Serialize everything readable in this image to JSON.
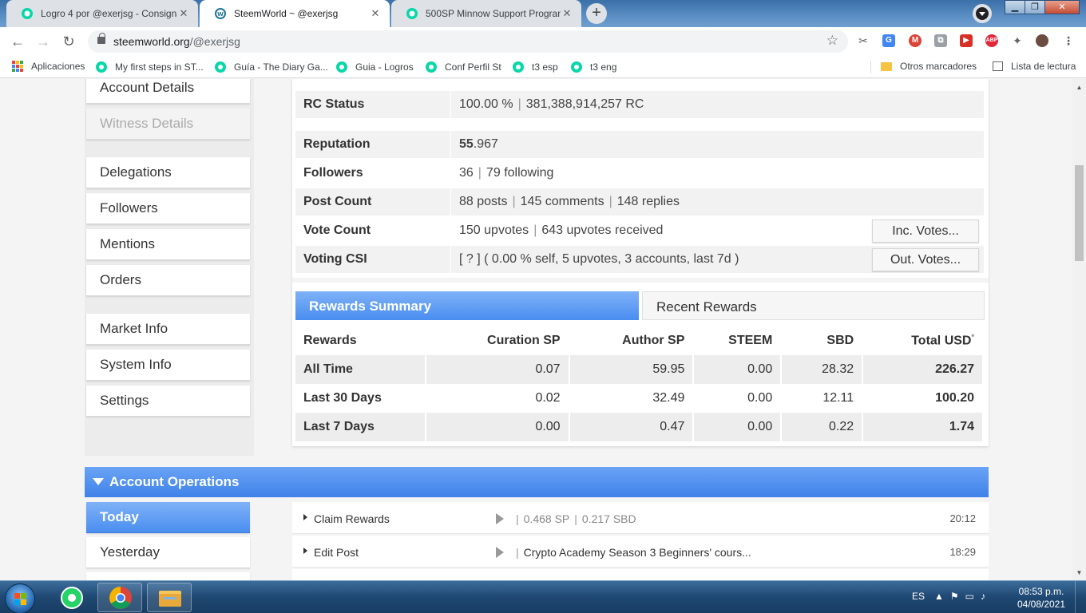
{
  "browser": {
    "tabs": [
      {
        "title": "Logro 4 por @exerjsg - Consigna",
        "active": false
      },
      {
        "title": "SteemWorld ~ @exerjsg",
        "active": true
      },
      {
        "title": "500SP Minnow Support Program",
        "active": false
      }
    ],
    "close_glyph": "✕",
    "new_tab_glyph": "+",
    "address": {
      "host": "steemworld.org",
      "path": "/@exerjsg"
    },
    "bookmarks": [
      {
        "label": "Aplicaciones"
      },
      {
        "label": "My first steps in ST..."
      },
      {
        "label": "Guía - The Diary Ga..."
      },
      {
        "label": "Guia - Logros"
      },
      {
        "label": "Conf Perfil St"
      },
      {
        "label": "t3 esp"
      },
      {
        "label": "t3 eng"
      }
    ],
    "other_bookmarks": "Otros marcadores",
    "reading_list": "Lista de lectura",
    "extensions": [
      {
        "label": "ABP",
        "color": "#e0283a"
      }
    ]
  },
  "sidebar": {
    "items": [
      {
        "label": "Account Details"
      },
      {
        "label": "Witness Details"
      },
      {
        "label": "Delegations"
      },
      {
        "label": "Followers"
      },
      {
        "label": "Mentions"
      },
      {
        "label": "Orders"
      },
      {
        "label": "Market Info"
      },
      {
        "label": "System Info"
      },
      {
        "label": "Settings"
      }
    ]
  },
  "account": {
    "rows": [
      {
        "key": "RC Status",
        "value": "100.00 %",
        "value2": "381,388,914,257 RC"
      },
      {
        "key": "Reputation",
        "value_bold": "55",
        "value_rest": ".967"
      },
      {
        "key": "Followers",
        "value": "36",
        "value2": "79 following"
      },
      {
        "key": "Post Count",
        "value": "88 posts",
        "value2": "145 comments",
        "value3": "148 replies"
      },
      {
        "key": "Vote Count",
        "value": "150 upvotes",
        "value2": "643 upvotes received",
        "button": "Inc. Votes..."
      },
      {
        "key": "Voting CSI",
        "value": "[ ? ] ( 0.00 % self, 5 upvotes, 3 accounts, last 7d )",
        "button": "Out. Votes..."
      }
    ],
    "separator": "|"
  },
  "rewards": {
    "tabs": {
      "summary": "Rewards Summary",
      "recent": "Recent Rewards"
    },
    "columns": [
      "Rewards",
      "Curation SP",
      "Author SP",
      "STEEM",
      "SBD",
      "Total USD"
    ],
    "total_marker": "*",
    "rows": [
      {
        "label": "All Time",
        "curation": "0.07",
        "author": "59.95",
        "steem": "0.00",
        "sbd": "28.32",
        "total": "226.27"
      },
      {
        "label": "Last 30 Days",
        "curation": "0.02",
        "author": "32.49",
        "steem": "0.00",
        "sbd": "12.11",
        "total": "100.20"
      },
      {
        "label": "Last 7 Days",
        "curation": "0.00",
        "author": "0.47",
        "steem": "0.00",
        "sbd": "0.22",
        "total": "1.74"
      }
    ]
  },
  "operations": {
    "title": "Account Operations",
    "days": [
      {
        "label": "Today"
      },
      {
        "label": "Yesterday"
      }
    ],
    "items": [
      {
        "type": "Claim Rewards",
        "detail": "0.468 SP",
        "detail2": "0.217 SBD",
        "time": "20:12"
      },
      {
        "type": "Edit Post",
        "detail": "Crypto Academy Season 3 Beginners' cours...",
        "time": "18:29"
      }
    ]
  },
  "taskbar": {
    "lang": "ES",
    "time": "08:53 p.m.",
    "date": "04/08/2021"
  }
}
